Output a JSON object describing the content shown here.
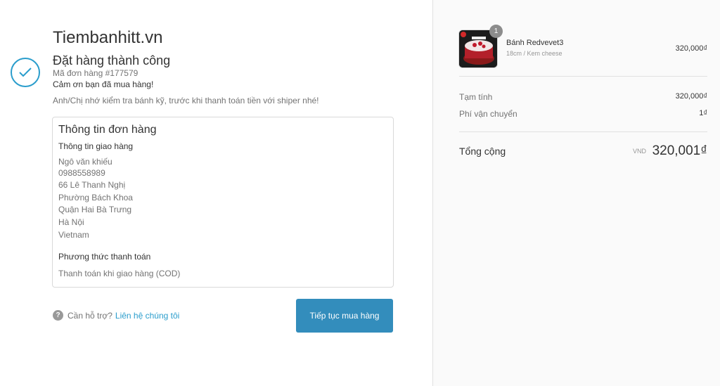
{
  "store": {
    "name": "Tiembanhitt.vn"
  },
  "confirmation": {
    "title": "Đặt hàng thành công",
    "order_number": "Mã đơn hàng #177579",
    "thanks": "Cảm ơn bạn đã mua hàng!",
    "note": "Anh/Chị nhớ kiểm tra bánh kỹ, trước khi thanh toán tiền với shiper nhé!"
  },
  "order_info": {
    "title": "Thông tin đơn hàng",
    "shipping_title": "Thông tin giao hàng",
    "address_lines": [
      "Ngô văn khiếu",
      "0988558989",
      "66 Lê Thanh Nghị",
      "Phường Bách Khoa",
      "Quận Hai Bà Trưng",
      "Hà Nội",
      "Vietnam"
    ],
    "payment_title": "Phương thức thanh toán",
    "payment_method": "Thanh toán khi giao hàng (COD)"
  },
  "help": {
    "icon": "question-icon",
    "label": "Cần hỗ trợ?",
    "link": "Liên hệ chúng tôi"
  },
  "actions": {
    "continue_label": "Tiếp tục mua hàng"
  },
  "cart": {
    "items": [
      {
        "name": "Bánh Redvevet3",
        "variant": "18cm / Kem cheese",
        "quantity": "1",
        "price": "320,000₫"
      }
    ],
    "subtotal_label": "Tạm tính",
    "subtotal": "320,000₫",
    "shipping_label": "Phí vận chuyển",
    "shipping": "1₫",
    "total_label": "Tổng cộng",
    "currency": "VND",
    "total": "320,001₫"
  },
  "colors": {
    "accent": "#2a9dcc",
    "button": "#338dbc",
    "sidebar_bg": "#fafafa"
  }
}
